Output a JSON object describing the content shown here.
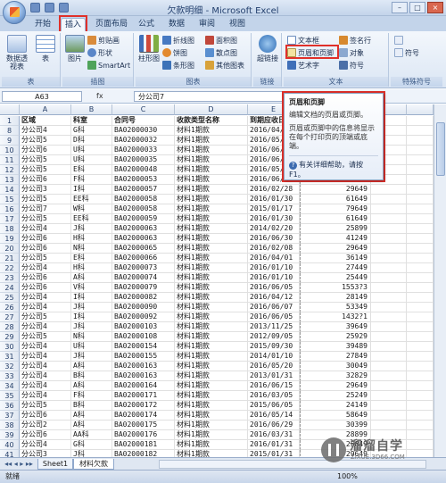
{
  "window": {
    "title": "欠款明细 - Microsoft Excel",
    "min": "–",
    "max": "□",
    "close": "×"
  },
  "tabs": [
    "开始",
    "插入",
    "页面布局",
    "公式",
    "数据",
    "审阅",
    "视图"
  ],
  "ribbon": {
    "table_group": {
      "label": "表",
      "pivot": "数据透视表",
      "table": "表"
    },
    "illus_group": {
      "label": "插图",
      "picture": "图片",
      "clipart": "剪贴画",
      "shapes": "形状",
      "smartart": "SmartArt"
    },
    "chart_group": {
      "label": "图表",
      "column": "柱形图",
      "line": "折线图",
      "pie": "饼图",
      "bar": "条形图",
      "area": "面积图",
      "scatter": "散点图",
      "other": "其他图表"
    },
    "link_group": {
      "label": "链接",
      "hyperlink": "超链接"
    },
    "text_group": {
      "label": "文本",
      "textbox": "文本框",
      "header_footer": "页眉和页脚",
      "wordart": "艺术字",
      "signature": "签名行",
      "object": "对象",
      "symbol_btn": "符号"
    },
    "special_group": {
      "label": "特殊符号",
      "symbol": "符号"
    }
  },
  "formula": {
    "name_box": "A63",
    "fx": "fx",
    "value": "分公司7"
  },
  "columns": [
    "A",
    "B",
    "C",
    "D",
    "E",
    "F"
  ],
  "rows": [
    {
      "n": "1",
      "a": "区域",
      "b": "科室",
      "c": "合同号",
      "d": "收款类型名称",
      "e": "到期应收日",
      "f": ""
    },
    {
      "n": "8",
      "a": "分公司4",
      "b": "G科",
      "c": "BA02000030",
      "d": "材料1期款",
      "e": "2016/04/2",
      "f": ""
    },
    {
      "n": "9",
      "a": "分公司5",
      "b": "D科",
      "c": "BA02000032",
      "d": "材料1期款",
      "e": "2016/05/3",
      "f": ""
    },
    {
      "n": "10",
      "a": "分公司6",
      "b": "U科",
      "c": "BA02000033",
      "d": "材料1期款",
      "e": "2016/06/1",
      "f": ""
    },
    {
      "n": "11",
      "a": "分公司5",
      "b": "U科",
      "c": "BA02000035",
      "d": "材料1期款",
      "e": "2016/06/0",
      "f": ""
    },
    {
      "n": "12",
      "a": "分公司5",
      "b": "E科",
      "c": "BA02000048",
      "d": "材料1期款",
      "e": "2016/05/3",
      "f": ""
    },
    {
      "n": "13",
      "a": "分公司6",
      "b": "F科",
      "c": "BA02000053",
      "d": "材料1期款",
      "e": "2016/06/1",
      "f": ""
    },
    {
      "n": "14",
      "a": "分公司3",
      "b": "I科",
      "c": "BA02000057",
      "d": "材料1期款",
      "e": "2016/02/28",
      "f": "29649"
    },
    {
      "n": "15",
      "a": "分公司5",
      "b": "EE科",
      "c": "BA02000058",
      "d": "材料1期款",
      "e": "2016/01/30",
      "f": "61649"
    },
    {
      "n": "16",
      "a": "分公司7",
      "b": "W科",
      "c": "BA02000058",
      "d": "材料1期款",
      "e": "2015/01/17",
      "f": "79649"
    },
    {
      "n": "17",
      "a": "分公司5",
      "b": "EE科",
      "c": "BA02000059",
      "d": "材料1期款",
      "e": "2016/01/30",
      "f": "61649"
    },
    {
      "n": "18",
      "a": "分公司4",
      "b": "J科",
      "c": "BA02000063",
      "d": "材料1期款",
      "e": "2014/02/20",
      "f": "25899"
    },
    {
      "n": "19",
      "a": "分公司6",
      "b": "H科",
      "c": "BA02000063",
      "d": "材料1期款",
      "e": "2016/06/30",
      "f": "41249"
    },
    {
      "n": "20",
      "a": "分公司6",
      "b": "N科",
      "c": "BA02000065",
      "d": "材料1期款",
      "e": "2016/02/08",
      "f": "29649"
    },
    {
      "n": "21",
      "a": "分公司5",
      "b": "E科",
      "c": "BA02000066",
      "d": "材料1期款",
      "e": "2016/04/01",
      "f": "36149"
    },
    {
      "n": "22",
      "a": "分公司4",
      "b": "H科",
      "c": "BA02000073",
      "d": "材料1期款",
      "e": "2016/01/10",
      "f": "27449"
    },
    {
      "n": "23",
      "a": "分公司6",
      "b": "A科",
      "c": "BA02000074",
      "d": "材料1期款",
      "e": "2016/01/10",
      "f": "25449"
    },
    {
      "n": "24",
      "a": "分公司6",
      "b": "V科",
      "c": "BA02000079",
      "d": "材料1期款",
      "e": "2016/06/05",
      "f": "1553?3"
    },
    {
      "n": "25",
      "a": "分公司4",
      "b": "I科",
      "c": "BA02000082",
      "d": "材料1期款",
      "e": "2016/04/12",
      "f": "28149"
    },
    {
      "n": "26",
      "a": "分公司4",
      "b": "J科",
      "c": "BA02000090",
      "d": "材料1期款",
      "e": "2016/06/07",
      "f": "53349"
    },
    {
      "n": "27",
      "a": "分公司5",
      "b": "I科",
      "c": "BA02000092",
      "d": "材料1期款",
      "e": "2016/06/05",
      "f": "1432?1"
    },
    {
      "n": "28",
      "a": "分公司4",
      "b": "J科",
      "c": "BA02000103",
      "d": "材料1期款",
      "e": "2013/11/25",
      "f": "39649"
    },
    {
      "n": "29",
      "a": "分公司5",
      "b": "N科",
      "c": "BA02000108",
      "d": "材料1期款",
      "e": "2012/09/05",
      "f": "25929"
    },
    {
      "n": "30",
      "a": "分公司4",
      "b": "U科",
      "c": "BA02000154",
      "d": "材料1期款",
      "e": "2015/09/30",
      "f": "39489"
    },
    {
      "n": "31",
      "a": "分公司4",
      "b": "J科",
      "c": "BA02000155",
      "d": "材料1期款",
      "e": "2014/01/10",
      "f": "27849"
    },
    {
      "n": "32",
      "a": "分公司4",
      "b": "A科",
      "c": "BA02000163",
      "d": "材料1期款",
      "e": "2016/05/20",
      "f": "30049"
    },
    {
      "n": "33",
      "a": "分公司4",
      "b": "B科",
      "c": "BA02000163",
      "d": "材料1期款",
      "e": "2013/01/31",
      "f": "32829"
    },
    {
      "n": "34",
      "a": "分公司4",
      "b": "A科",
      "c": "BA02000164",
      "d": "材料1期款",
      "e": "2016/06/15",
      "f": "29649"
    },
    {
      "n": "35",
      "a": "分公司4",
      "b": "F科",
      "c": "BA02000171",
      "d": "材料1期款",
      "e": "2016/03/05",
      "f": "25249"
    },
    {
      "n": "36",
      "a": "分公司5",
      "b": "B科",
      "c": "BA02000172",
      "d": "材料1期款",
      "e": "2015/06/05",
      "f": "24149"
    },
    {
      "n": "37",
      "a": "分公司6",
      "b": "A科",
      "c": "BA02000174",
      "d": "材料1期款",
      "e": "2016/05/14",
      "f": "58649"
    },
    {
      "n": "38",
      "a": "分公司2",
      "b": "A科",
      "c": "BA02000175",
      "d": "材料1期款",
      "e": "2016/06/29",
      "f": "30399"
    },
    {
      "n": "39",
      "a": "分公司6",
      "b": "AA科",
      "c": "BA02000176",
      "d": "材料1期款",
      "e": "2016/03/31",
      "f": "28899"
    },
    {
      "n": "40",
      "a": "分公司4",
      "b": "G科",
      "c": "BA02000181",
      "d": "材料1期款",
      "e": "2016/01/31",
      "f": "25849"
    },
    {
      "n": "41",
      "a": "分公司3",
      "b": "J科",
      "c": "BA02000182",
      "d": "材料1期款",
      "e": "2015/01/31",
      "f": "29649"
    },
    {
      "n": "42",
      "a": "分公司4",
      "b": "G科",
      "c": "BA02000183",
      "d": "材料1期款",
      "e": "2016/06/30",
      "f": "35049"
    },
    {
      "n": "43",
      "a": "分公司5",
      "b": "A科",
      "c": "BA02000197",
      "d": "材料1期款",
      "e": "2016/07/05",
      "f": "29649"
    },
    {
      "n": "44",
      "a": "分公司3",
      "b": "I科",
      "c": "BA02000198",
      "d": "材料1期款",
      "e": "2016/03/31",
      "f": "21749"
    }
  ],
  "tooltip": {
    "title": "页眉和页脚",
    "desc": "编辑文档的页眉或页脚。",
    "detail": "页眉或页脚中的信息将显示在每个打印页的顶端或底端。",
    "help": "有关详细帮助，请按 F1。"
  },
  "sheets": [
    "Sheet1",
    "材料欠款"
  ],
  "status": {
    "left": "就绪",
    "zoom": "100%"
  },
  "watermark": {
    "brand": "溜溜自学",
    "site": "ZIXUE.3D66.COM"
  }
}
